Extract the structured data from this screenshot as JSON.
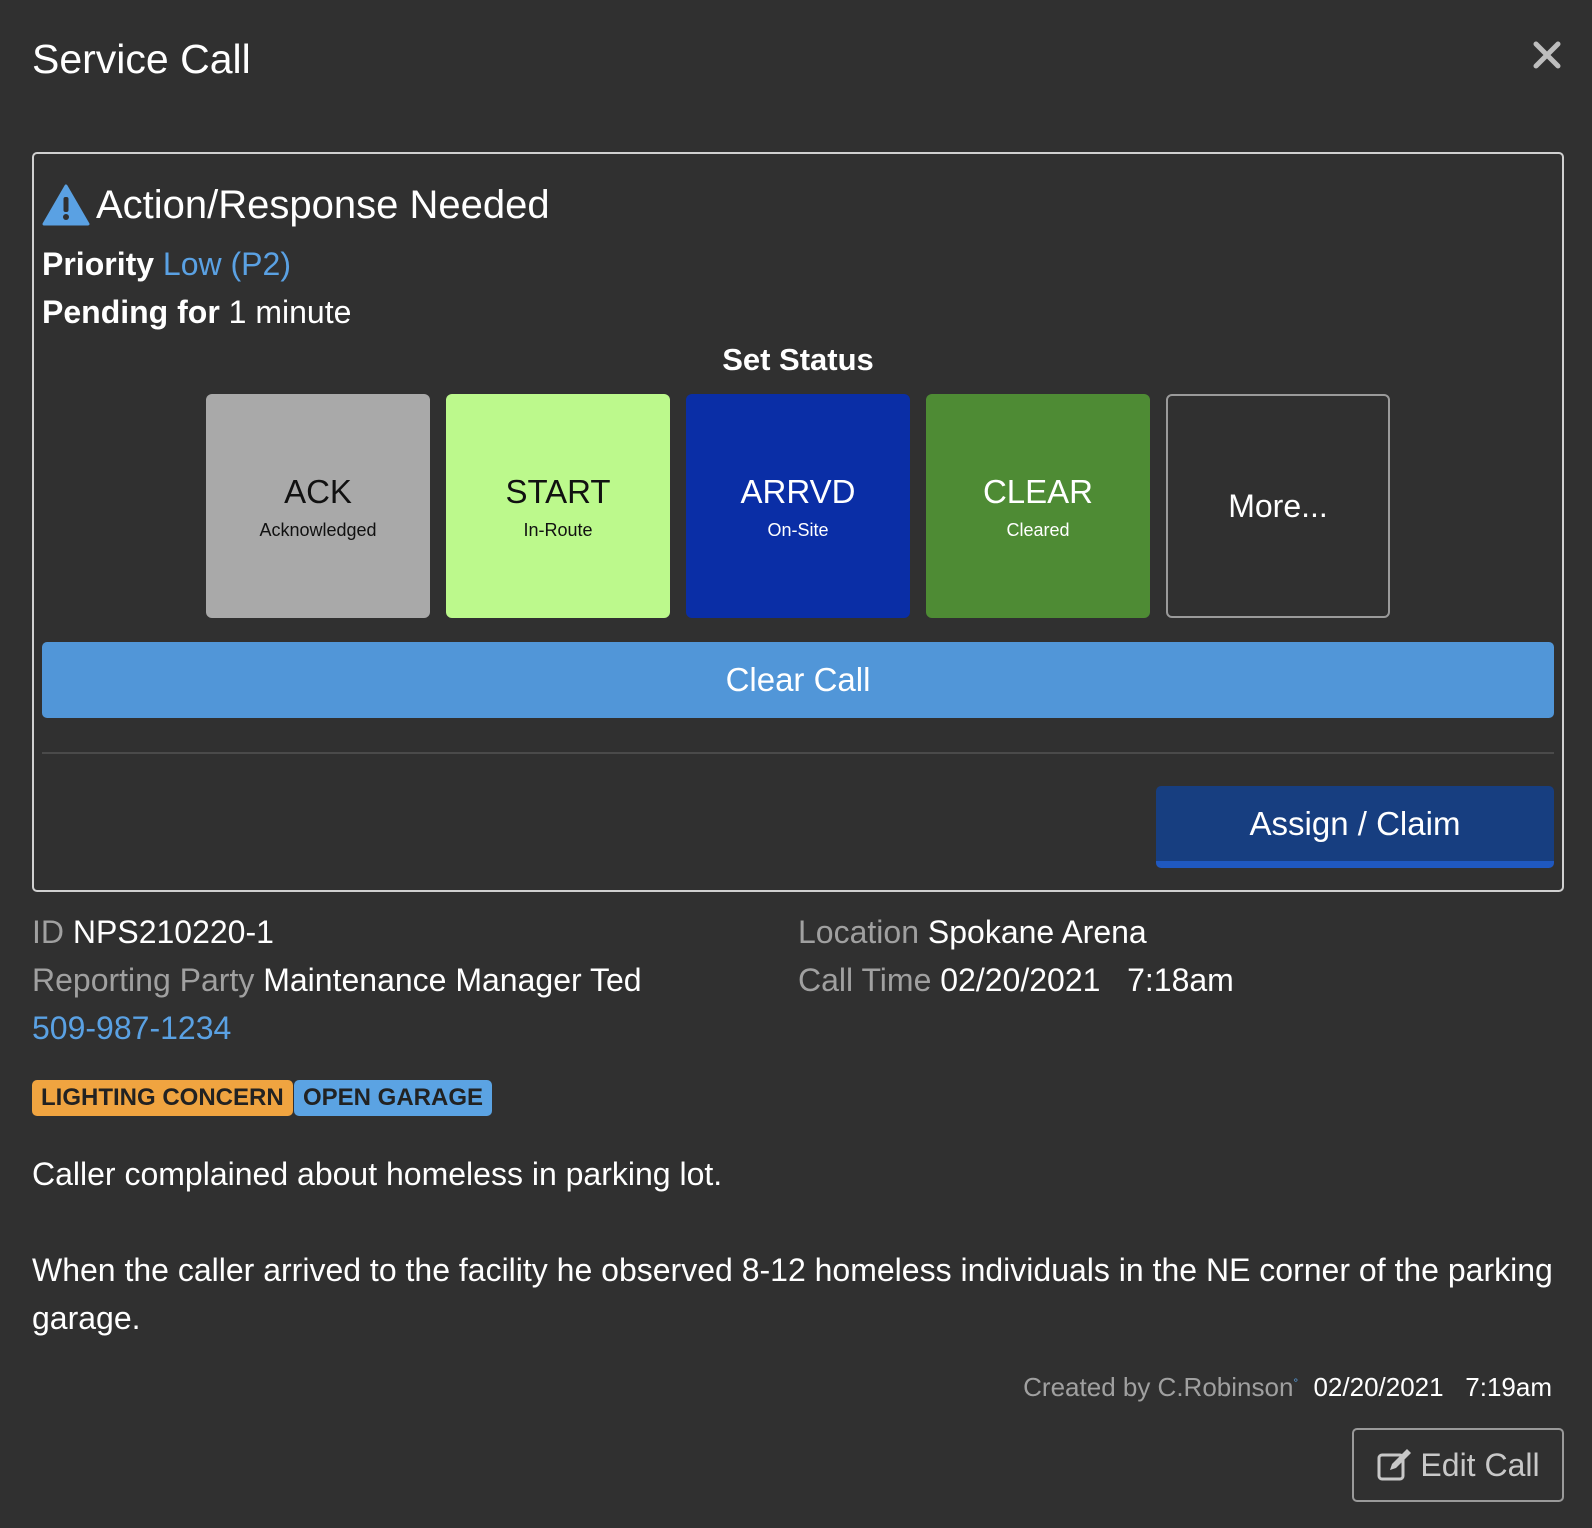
{
  "modal": {
    "title": "Service Call",
    "close_icon": "close-icon"
  },
  "alert": {
    "icon": "warning-icon",
    "heading": "Action/Response Needed",
    "priority_label": "Priority",
    "priority_value": "Low (P2)",
    "pending_label": "Pending for",
    "pending_value": "1 minute"
  },
  "status": {
    "label": "Set Status",
    "buttons": [
      {
        "code": "ACK",
        "sub": "Acknowledged",
        "color": "#a9a9a9"
      },
      {
        "code": "START",
        "sub": "In-Route",
        "color": "#bcf98c"
      },
      {
        "code": "ARRVD",
        "sub": "On-Site",
        "color": "#0a2ea6"
      },
      {
        "code": "CLEAR",
        "sub": "Cleared",
        "color": "#4e8b34"
      },
      {
        "code": "More...",
        "sub": ""
      }
    ]
  },
  "actions": {
    "clear_call": "Clear Call",
    "assign_claim": "Assign / Claim"
  },
  "details": {
    "id_label": "ID",
    "id_value": "NPS210220-1",
    "reporting_label": "Reporting Party",
    "reporting_value": "Maintenance Manager Ted",
    "phone": "509-987-1234",
    "location_label": "Location",
    "location_value": "Spokane Arena",
    "call_time_label": "Call Time",
    "call_time_value": "02/20/2021   7:18am"
  },
  "tags": [
    {
      "label": "LIGHTING CONCERN",
      "color": "#f0a440"
    },
    {
      "label": "OPEN GARAGE",
      "color": "#5ba3e3"
    }
  ],
  "description": {
    "line1": "Caller complained about homeless in parking lot.",
    "line2": "When the caller arrived to the facility he observed 8-12 homeless individuals in the NE corner of the parking garage."
  },
  "footer": {
    "created_label": "Created by C.Robinson",
    "created_value": "02/20/2021   7:19am",
    "edit_label": "Edit Call",
    "edit_icon": "edit-icon"
  }
}
